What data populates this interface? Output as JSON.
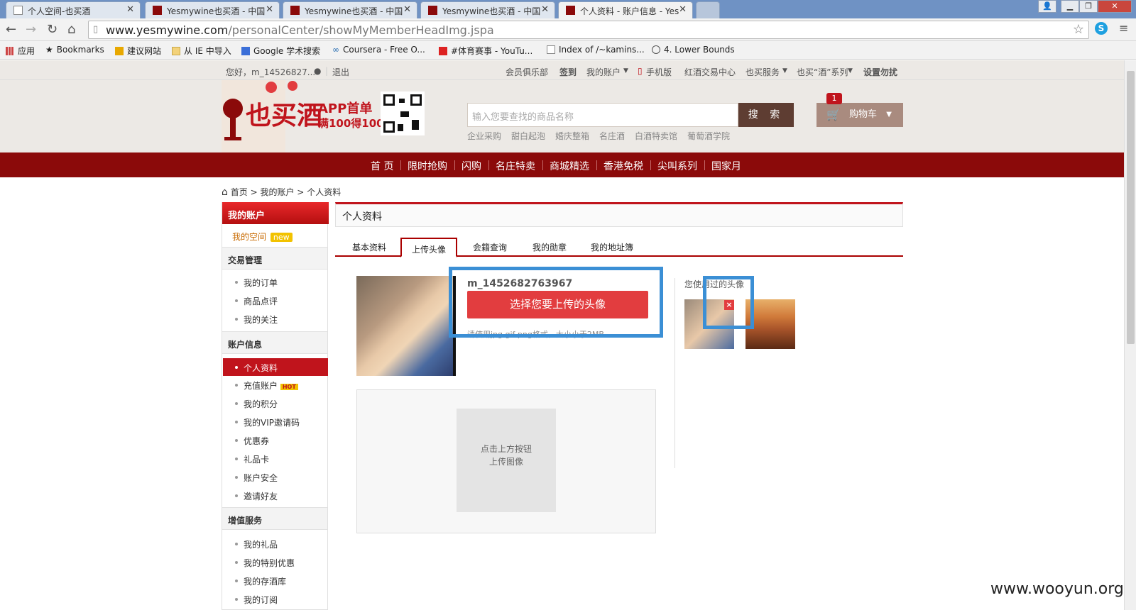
{
  "browser": {
    "tabs": [
      {
        "title": "个人空间-也买酒"
      },
      {
        "title": "Yesmywine也买酒 - 中国"
      },
      {
        "title": "Yesmywine也买酒 - 中国"
      },
      {
        "title": "Yesmywine也买酒 - 中国"
      },
      {
        "title": "个人资料 - 账户信息 - Yes"
      }
    ],
    "url_host": "www.yesmywine.com",
    "url_path": "/personalCenter/showMyMemberHeadImg.jspa",
    "bookmarks": [
      {
        "label": "应用",
        "icon": "apps-icon"
      },
      {
        "label": "Bookmarks",
        "icon": "star-icon"
      },
      {
        "label": "建议网站",
        "icon": "bing-icon"
      },
      {
        "label": "从 IE 中导入",
        "icon": "folder-icon"
      },
      {
        "label": "Google 学术搜索",
        "icon": "scholar-icon"
      },
      {
        "label": "Coursera - Free O...",
        "icon": "coursera-icon"
      },
      {
        "label": "#体育赛事 - YouTu...",
        "icon": "youtube-icon"
      },
      {
        "label": "Index of /~kamins...",
        "icon": "page-icon"
      },
      {
        "label": "4. Lower Bounds",
        "icon": "globe-icon"
      }
    ]
  },
  "topbar": {
    "greeting": "您好，m_14526827...",
    "logout": "退出",
    "links": [
      "会员俱乐部",
      "签到",
      "我的账户",
      "手机版",
      "红酒交易中心",
      "也买服务",
      "也买“酒”系列",
      "设置勿扰"
    ]
  },
  "header": {
    "promo_line1": "APP首单",
    "promo_line2": "满100得100",
    "search_placeholder": "输入您要查找的商品名称",
    "search_button": "搜 索",
    "cart_label": "购物车",
    "cart_count": "1",
    "hot_links": [
      "企业采购",
      "甜白起泡",
      "婚庆整箱",
      "名庄酒",
      "白酒特卖馆",
      "葡萄酒学院"
    ]
  },
  "mainnav": [
    "首 页",
    "限时抢购",
    "闪购",
    "名庄特卖",
    "商城精选",
    "香港免税",
    "尖叫系列",
    "国家月"
  ],
  "breadcrumb": {
    "home": "首页",
    "account": "我的账户",
    "current": "个人资料",
    "sep": ">"
  },
  "sidebar": {
    "title": "我的账户",
    "myspace": "我的空间",
    "new_badge": "new",
    "groups": [
      {
        "title": "交易管理",
        "items": [
          "我的订单",
          "商品点评",
          "我的关注"
        ]
      },
      {
        "title": "账户信息",
        "items": [
          "个人资料",
          "充值账户",
          "我的积分",
          "我的VIP邀请码",
          "优惠券",
          "礼品卡",
          "账户安全",
          "邀请好友"
        ]
      },
      {
        "title": "增值服务",
        "items": [
          "我的礼品",
          "我的特别优惠",
          "我的存酒库",
          "我的订阅"
        ]
      }
    ],
    "hot_badge": "HOT"
  },
  "content": {
    "title": "个人资料",
    "tabs": [
      "基本资料",
      "上传头像",
      "会籍查询",
      "我的勋章",
      "我的地址簿"
    ],
    "active_tab": "上传头像",
    "username": "m_1452682763967",
    "upload_button": "选择您要上传的头像",
    "upload_hint": "请使用jpg,gif,png格式，大小小于2MB",
    "used_avatars_label": "您使用过的头像",
    "delete_mark": "×",
    "preview_text_line1": "点击上方按钮",
    "preview_text_line2": "上传图像"
  },
  "watermark": "www.wooyun.org",
  "colors": {
    "brand_red": "#8b0a0a",
    "accent_red": "#c0141c",
    "highlight_blue": "#3b8fd5"
  }
}
